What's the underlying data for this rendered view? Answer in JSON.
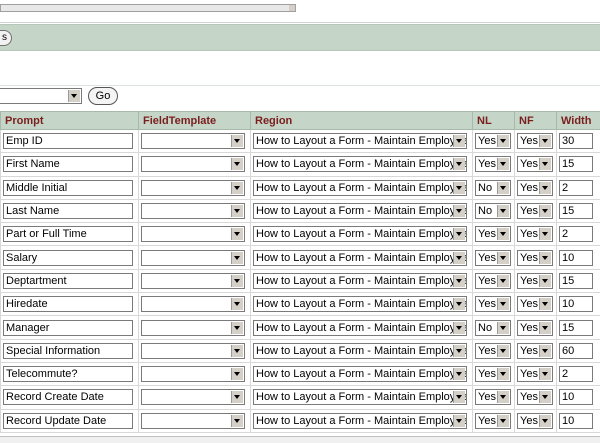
{
  "toolbar": {
    "partial_button_label": "s"
  },
  "filter": {
    "go_label": "Go"
  },
  "table": {
    "headers": [
      "Prompt",
      "FieldTemplate",
      "Region",
      "NL",
      "NF",
      "Width"
    ],
    "rows": [
      {
        "prompt": "Emp ID",
        "region": "How to Layout a Form - Maintain Employees",
        "nl": "Yes",
        "nf": "Yes",
        "width": "30"
      },
      {
        "prompt": "First Name",
        "region": "How to Layout a Form - Maintain Employees",
        "nl": "Yes",
        "nf": "Yes",
        "width": "15"
      },
      {
        "prompt": "Middle Initial",
        "region": "How to Layout a Form - Maintain Employees",
        "nl": "No",
        "nf": "Yes",
        "width": "2"
      },
      {
        "prompt": "Last Name",
        "region": "How to Layout a Form - Maintain Employees",
        "nl": "No",
        "nf": "Yes",
        "width": "15"
      },
      {
        "prompt": "Part or Full Time",
        "region": "How to Layout a Form - Maintain Employees",
        "nl": "Yes",
        "nf": "Yes",
        "width": "2"
      },
      {
        "prompt": "Salary",
        "region": "How to Layout a Form - Maintain Employees",
        "nl": "Yes",
        "nf": "Yes",
        "width": "10"
      },
      {
        "prompt": "Deptartment",
        "region": "How to Layout a Form - Maintain Employees",
        "nl": "Yes",
        "nf": "Yes",
        "width": "15"
      },
      {
        "prompt": "Hiredate",
        "region": "How to Layout a Form - Maintain Employees",
        "nl": "Yes",
        "nf": "Yes",
        "width": "10"
      },
      {
        "prompt": "Manager",
        "region": "How to Layout a Form - Maintain Employees",
        "nl": "No",
        "nf": "Yes",
        "width": "15"
      },
      {
        "prompt": "Special Information",
        "region": "How to Layout a Form - Maintain Employees",
        "nl": "Yes",
        "nf": "Yes",
        "width": "60"
      },
      {
        "prompt": "Telecommute?",
        "region": "How to Layout a Form - Maintain Employees",
        "nl": "Yes",
        "nf": "Yes",
        "width": "2"
      },
      {
        "prompt": "Record Create Date",
        "region": "How to Layout a Form - Maintain Employees",
        "nl": "Yes",
        "nf": "Yes",
        "width": "10"
      },
      {
        "prompt": "Record Update Date",
        "region": "How to Layout a Form - Maintain Employees",
        "nl": "Yes",
        "nf": "Yes",
        "width": "10"
      }
    ]
  },
  "colors": {
    "header_band": "#c5d6c8",
    "header_text": "#7a1e1e"
  }
}
